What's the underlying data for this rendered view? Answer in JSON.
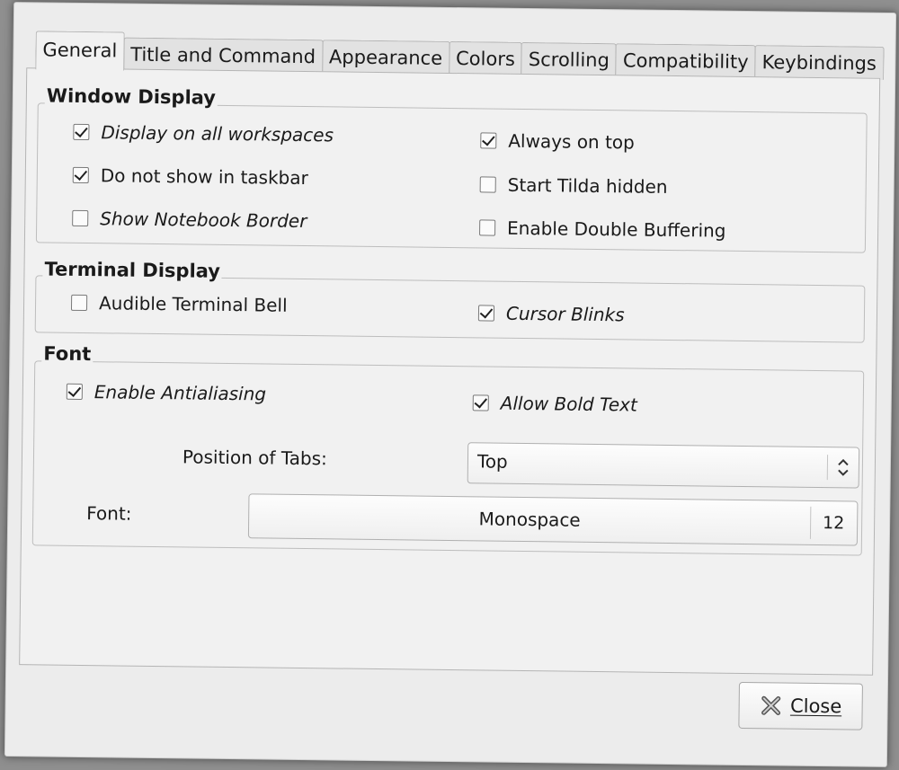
{
  "tabs": [
    {
      "label": "General",
      "active": true
    },
    {
      "label": "Title and Command",
      "active": false
    },
    {
      "label": "Appearance",
      "active": false
    },
    {
      "label": "Colors",
      "active": false
    },
    {
      "label": "Scrolling",
      "active": false
    },
    {
      "label": "Compatibility",
      "active": false
    },
    {
      "label": "Keybindings",
      "active": false
    }
  ],
  "window_display": {
    "title": "Window Display",
    "display_all_workspaces": {
      "label": "Display on all workspaces",
      "checked": true
    },
    "always_on_top": {
      "label": "Always on top",
      "checked": true
    },
    "not_in_taskbar": {
      "label": "Do not show in taskbar",
      "checked": true
    },
    "start_hidden": {
      "label": "Start Tilda hidden",
      "checked": false
    },
    "notebook_border": {
      "label": "Show Notebook Border",
      "checked": false
    },
    "double_buffering": {
      "label": "Enable Double Buffering",
      "checked": false
    }
  },
  "terminal_display": {
    "title": "Terminal Display",
    "audible_bell": {
      "label": "Audible Terminal Bell",
      "checked": false
    },
    "cursor_blinks": {
      "label": "Cursor Blinks",
      "checked": true
    }
  },
  "font_section": {
    "title": "Font",
    "antialiasing": {
      "label": "Enable Antialiasing",
      "checked": true
    },
    "bold_text": {
      "label": "Allow Bold Text",
      "checked": true
    },
    "tabs_position_label": "Position of Tabs:",
    "tabs_position_value": "Top",
    "font_label": "Font:",
    "font_name": "Monospace",
    "font_size": "12"
  },
  "close_button": {
    "label": "Close",
    "icon": "close-icon"
  }
}
